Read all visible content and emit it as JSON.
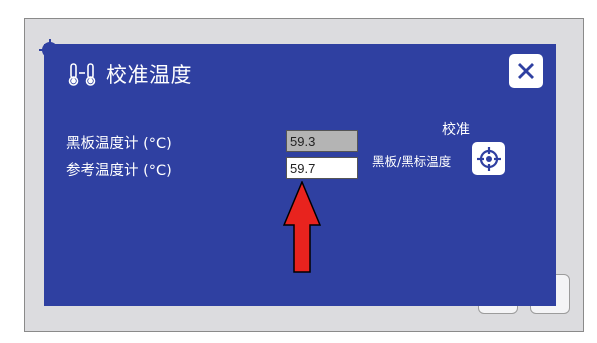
{
  "dialog": {
    "title": "校准温度",
    "title_icon": "thermometer-icon",
    "close_icon": "close-icon"
  },
  "rows": [
    {
      "label": "黑板温度计 (°C)",
      "value": "59.3",
      "readonly": true
    },
    {
      "label": "参考温度计 (°C)",
      "value": "59.7",
      "readonly": false
    }
  ],
  "calibration": {
    "heading": "校准",
    "label": "黑板/黑标温度",
    "icon": "crosshair-target-icon"
  },
  "annotation": {
    "arrow_color": "#e8231e",
    "arrow_icon": "red-up-arrow"
  },
  "colors": {
    "dialog_bg": "#2f40a1",
    "screen_bg": "#dcdcdf",
    "readonly_field": "#b4b4b4"
  }
}
